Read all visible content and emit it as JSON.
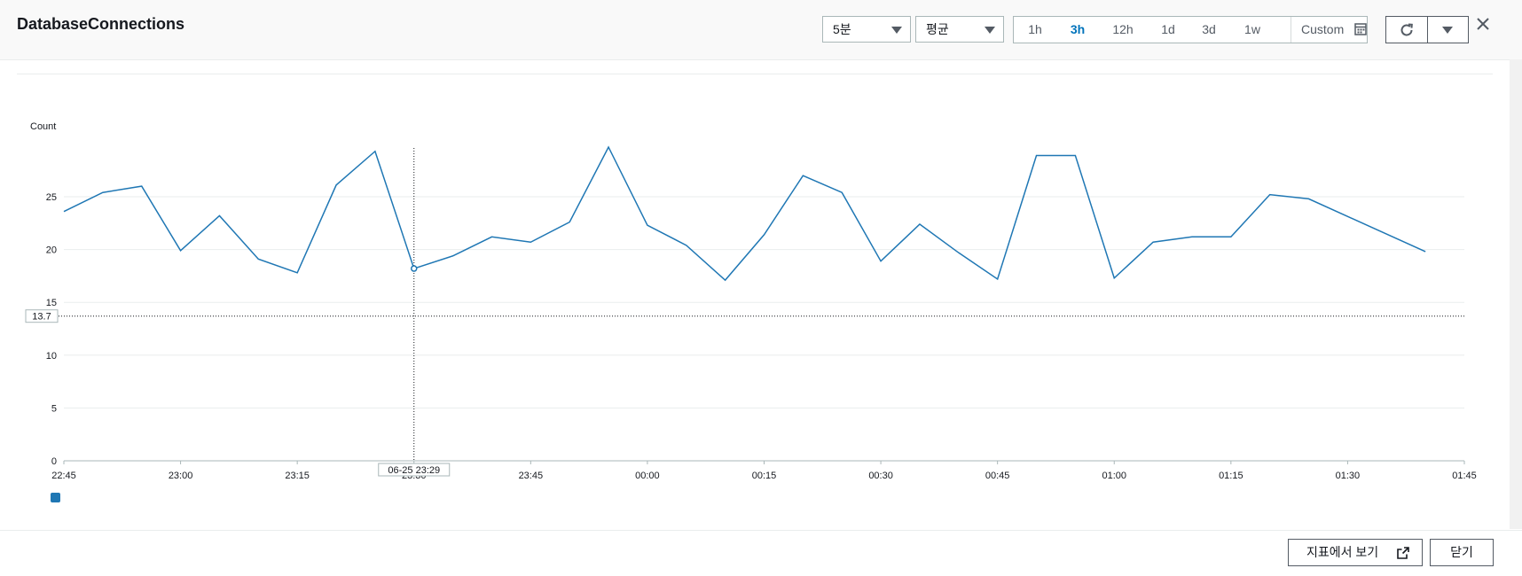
{
  "header": {
    "title": "DatabaseConnections",
    "period_select": "5분",
    "stat_select": "평균",
    "time_ranges": [
      "1h",
      "3h",
      "12h",
      "1d",
      "3d",
      "1w"
    ],
    "active_range": "3h",
    "custom_label": "Custom",
    "refresh_icon": "refresh-icon",
    "close_icon": "close-icon"
  },
  "chart_data": {
    "type": "line",
    "ylabel": "Count",
    "ylim": [
      0,
      30
    ],
    "yticks": [
      0,
      5,
      10,
      15,
      20,
      25
    ],
    "x_range": [
      "22:45",
      "01:45"
    ],
    "xticks": [
      "22:45",
      "23:00",
      "23:15",
      "23:30",
      "23:45",
      "00:00",
      "00:15",
      "00:30",
      "00:45",
      "01:00",
      "01:15",
      "01:30",
      "01:45"
    ],
    "grid": true,
    "legend": "bottom-left",
    "color": "#1f77b4",
    "series": [
      {
        "x": [
          "22:45",
          "22:50",
          "22:55",
          "23:00",
          "23:05",
          "23:10",
          "23:15",
          "23:20",
          "23:25",
          "23:30",
          "23:35",
          "23:40",
          "23:45",
          "23:50",
          "23:55",
          "00:00",
          "00:05",
          "00:10",
          "00:15",
          "00:20",
          "00:25",
          "00:30",
          "00:35",
          "00:40",
          "00:45",
          "00:50",
          "00:55",
          "01:00",
          "01:05",
          "01:10",
          "01:15",
          "01:20",
          "01:25",
          "01:40"
        ],
        "values": [
          23.6,
          25.4,
          26.0,
          19.9,
          23.2,
          19.1,
          17.8,
          26.1,
          29.3,
          18.2,
          19.4,
          21.2,
          20.7,
          22.6,
          29.7,
          22.3,
          20.4,
          17.1,
          21.4,
          27.0,
          25.4,
          18.9,
          22.4,
          19.7,
          17.2,
          28.9,
          28.9,
          17.3,
          20.7,
          21.2,
          21.2,
          25.2,
          24.8,
          19.8
        ]
      }
    ],
    "crosshair": {
      "x_label": "06-25 23:29",
      "y_label": "13.7",
      "x_value": "23:30",
      "y_value": 13.7
    }
  },
  "footer": {
    "view_in_metrics": "지표에서 보기",
    "close": "닫기"
  }
}
